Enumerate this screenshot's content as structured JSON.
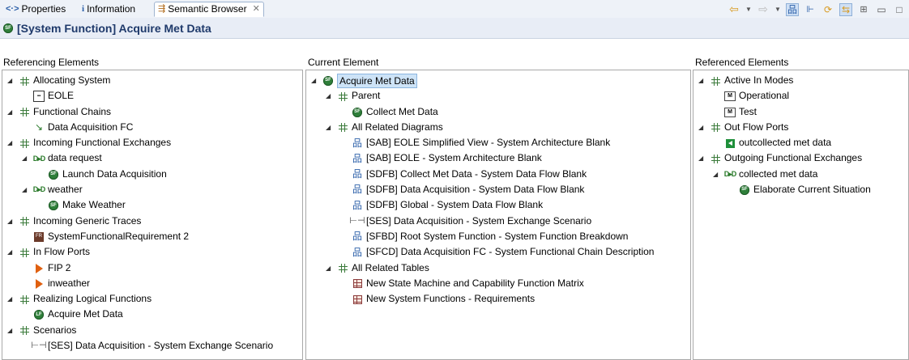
{
  "tabs": [
    {
      "label": "Properties",
      "icon": "properties-icon",
      "glyph": "<·>",
      "active": false
    },
    {
      "label": "Information",
      "icon": "information-icon",
      "glyph": "i",
      "active": false
    },
    {
      "label": "Semantic Browser",
      "icon": "semantic-browser-icon",
      "glyph": "⇶",
      "active": true
    }
  ],
  "title": "[System Function] Acquire Met Data",
  "panes": {
    "referencing": {
      "header": "Referencing Elements",
      "rows": [
        {
          "level": 0,
          "twisty": true,
          "icon": "category",
          "label": "Allocating System"
        },
        {
          "level": 1,
          "twisty": false,
          "icon": "component",
          "label": "EOLE"
        },
        {
          "level": 0,
          "twisty": true,
          "icon": "category",
          "label": "Functional Chains"
        },
        {
          "level": 1,
          "twisty": false,
          "icon": "chain",
          "label": "Data Acquisition FC"
        },
        {
          "level": 0,
          "twisty": true,
          "icon": "category",
          "label": "Incoming Functional Exchanges"
        },
        {
          "level": 1,
          "twisty": true,
          "icon": "exchange",
          "label": "data request"
        },
        {
          "level": 2,
          "twisty": false,
          "icon": "function",
          "label": "Launch Data Acquisition"
        },
        {
          "level": 1,
          "twisty": true,
          "icon": "exchange",
          "label": "weather"
        },
        {
          "level": 2,
          "twisty": false,
          "icon": "function",
          "label": "Make Weather"
        },
        {
          "level": 0,
          "twisty": true,
          "icon": "category",
          "label": "Incoming Generic Traces"
        },
        {
          "level": 1,
          "twisty": false,
          "icon": "requirement",
          "label": "SystemFunctionalRequirement 2"
        },
        {
          "level": 0,
          "twisty": true,
          "icon": "category",
          "label": "In Flow Ports"
        },
        {
          "level": 1,
          "twisty": false,
          "icon": "inport",
          "label": "FIP 2"
        },
        {
          "level": 1,
          "twisty": false,
          "icon": "inport",
          "label": "inweather"
        },
        {
          "level": 0,
          "twisty": true,
          "icon": "category",
          "label": "Realizing Logical Functions"
        },
        {
          "level": 1,
          "twisty": false,
          "icon": "logical-function",
          "label": "Acquire Met Data"
        },
        {
          "level": 0,
          "twisty": true,
          "icon": "category",
          "label": "Scenarios"
        },
        {
          "level": 1,
          "twisty": false,
          "icon": "scenario",
          "label": "[SES] Data Acquisition - System Exchange Scenario"
        }
      ]
    },
    "current": {
      "header": "Current Element",
      "rows": [
        {
          "level": 0,
          "twisty": true,
          "icon": "function",
          "label": "Acquire Met Data",
          "selected": true
        },
        {
          "level": 1,
          "twisty": true,
          "icon": "category",
          "label": "Parent"
        },
        {
          "level": 2,
          "twisty": false,
          "icon": "function",
          "label": "Collect Met Data"
        },
        {
          "level": 1,
          "twisty": true,
          "icon": "category",
          "label": "All Related Diagrams"
        },
        {
          "level": 2,
          "twisty": false,
          "icon": "diagram",
          "label": "[SAB] EOLE Simplified View - System Architecture Blank"
        },
        {
          "level": 2,
          "twisty": false,
          "icon": "diagram",
          "label": "[SAB] EOLE - System Architecture Blank"
        },
        {
          "level": 2,
          "twisty": false,
          "icon": "diagram",
          "label": "[SDFB] Collect Met Data - System Data Flow Blank"
        },
        {
          "level": 2,
          "twisty": false,
          "icon": "diagram",
          "label": "[SDFB] Data Acquisition - System Data Flow Blank"
        },
        {
          "level": 2,
          "twisty": false,
          "icon": "diagram",
          "label": "[SDFB] Global - System Data Flow Blank"
        },
        {
          "level": 2,
          "twisty": false,
          "icon": "scenario",
          "label": "[SES] Data Acquisition - System Exchange Scenario"
        },
        {
          "level": 2,
          "twisty": false,
          "icon": "diagram",
          "label": "[SFBD] Root System Function - System Function Breakdown"
        },
        {
          "level": 2,
          "twisty": false,
          "icon": "diagram",
          "label": "[SFCD] Data Acquisition FC - System Functional Chain Description"
        },
        {
          "level": 1,
          "twisty": true,
          "icon": "category",
          "label": "All Related Tables"
        },
        {
          "level": 2,
          "twisty": false,
          "icon": "table",
          "label": "New State Machine and Capability Function Matrix"
        },
        {
          "level": 2,
          "twisty": false,
          "icon": "table",
          "label": "New System Functions - Requirements"
        }
      ]
    },
    "referenced": {
      "header": "Referenced Elements",
      "rows": [
        {
          "level": 0,
          "twisty": true,
          "icon": "category",
          "label": "Active In Modes"
        },
        {
          "level": 1,
          "twisty": false,
          "icon": "mode",
          "label": "Operational"
        },
        {
          "level": 1,
          "twisty": false,
          "icon": "mode",
          "label": "Test"
        },
        {
          "level": 0,
          "twisty": true,
          "icon": "category",
          "label": "Out Flow Ports"
        },
        {
          "level": 1,
          "twisty": false,
          "icon": "outport",
          "label": "outcollected met data"
        },
        {
          "level": 0,
          "twisty": true,
          "icon": "category",
          "label": "Outgoing Functional Exchanges"
        },
        {
          "level": 1,
          "twisty": true,
          "icon": "exchange",
          "label": "collected met data"
        },
        {
          "level": 2,
          "twisty": false,
          "icon": "function",
          "label": "Elaborate Current Situation"
        }
      ]
    }
  },
  "toolbar": {
    "buttons": [
      "back-icon",
      "back-dropdown-icon",
      "forward-icon",
      "forward-dropdown-icon",
      "diagram-toggle-icon",
      "tree-icon",
      "refresh-icon",
      "link-icon",
      "layout-icon",
      "minimize-icon",
      "maximize-icon"
    ]
  }
}
